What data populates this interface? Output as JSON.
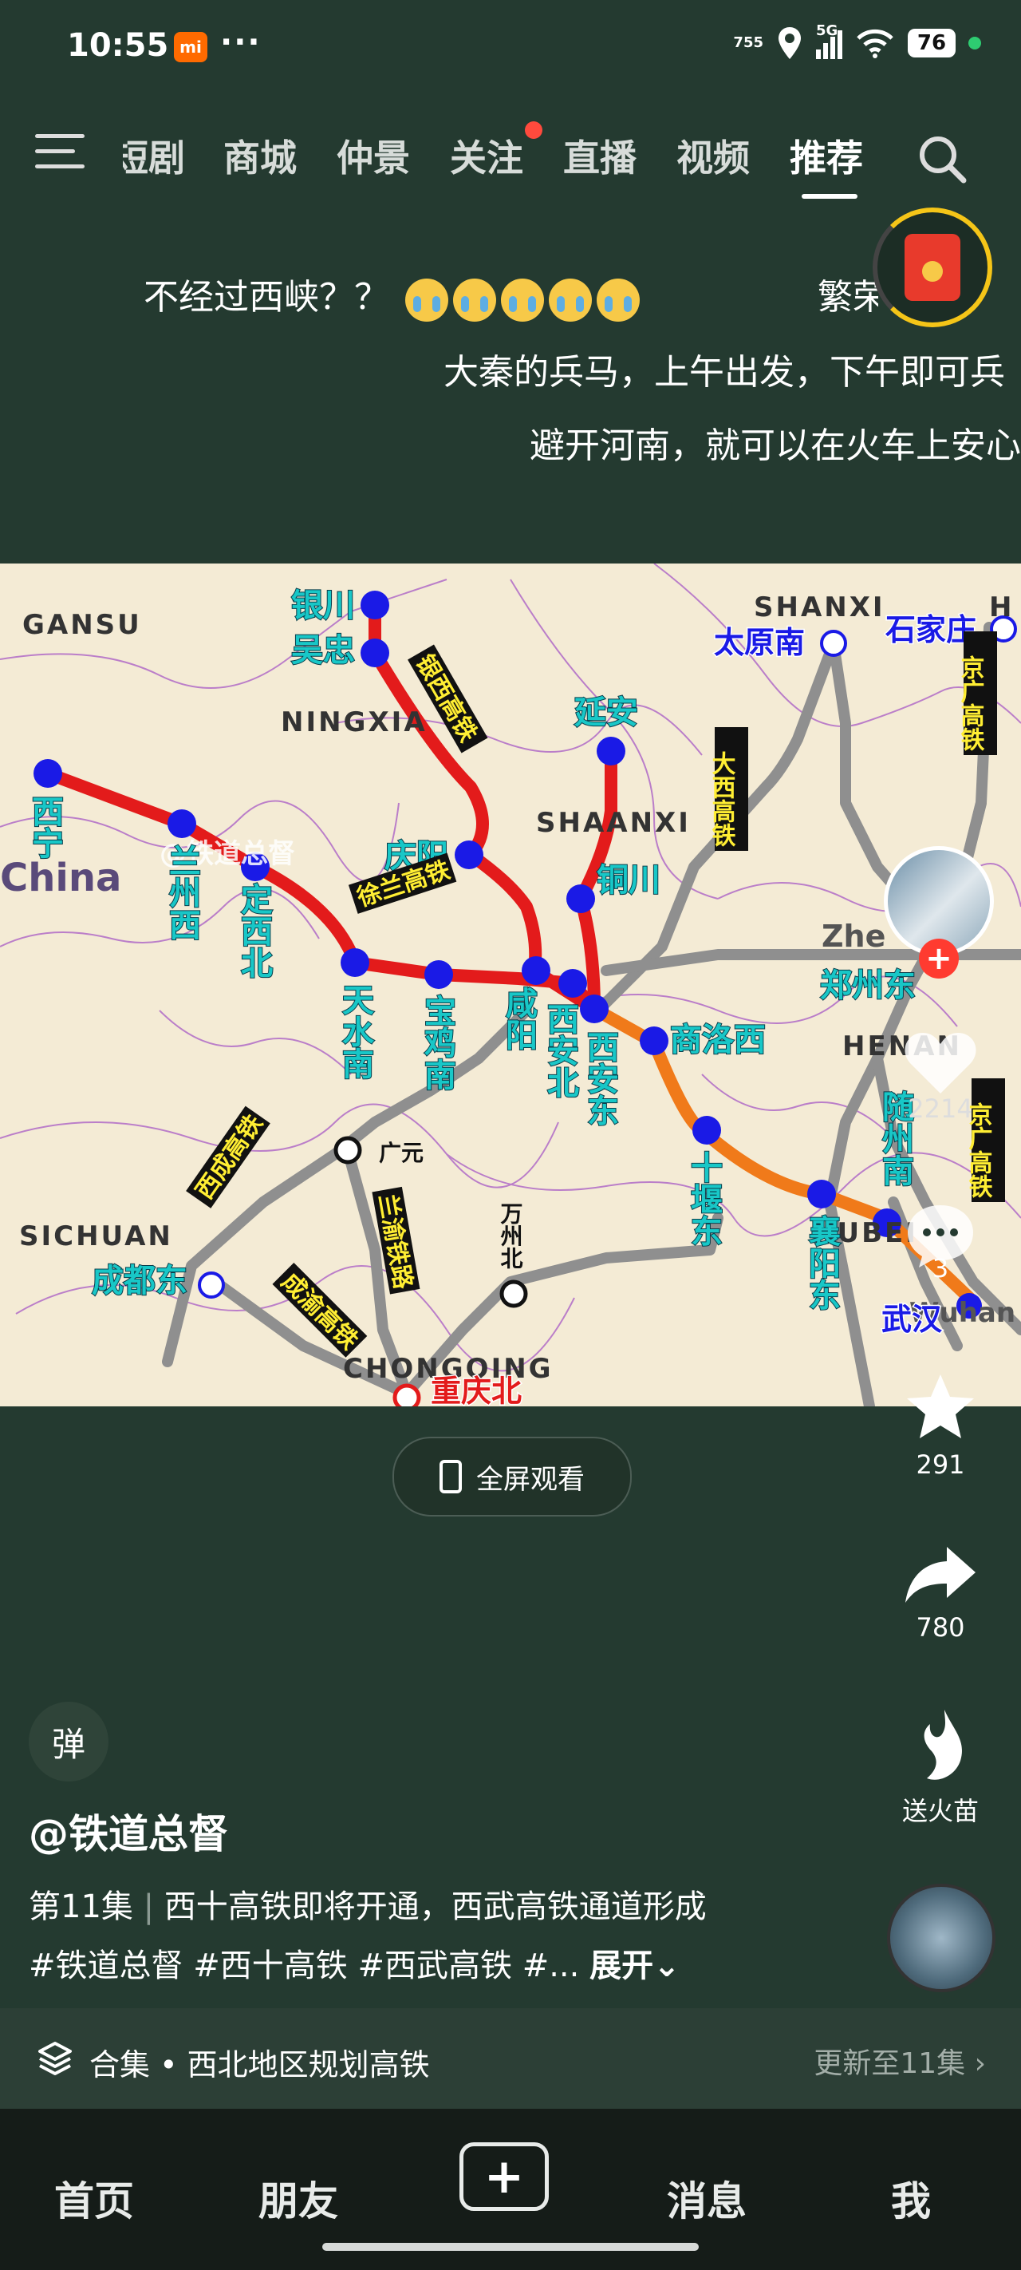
{
  "status_bar": {
    "time": "10:55",
    "mi_badge": "mi",
    "dots": "···",
    "net_rate_top": "755",
    "net_rate_bottom": "",
    "signal": "5G",
    "battery": "76"
  },
  "top_nav": {
    "tabs": [
      {
        "label": "短剧"
      },
      {
        "label": "商城"
      },
      {
        "label": "仲景"
      },
      {
        "label": "关注"
      },
      {
        "label": "直播"
      },
      {
        "label": "视频"
      },
      {
        "label": "推荐"
      }
    ],
    "active_tab": "推荐"
  },
  "danmaku": [
    {
      "text": "不经过西峡？？"
    },
    {
      "text": "繁荣昌盛"
    },
    {
      "text": "大秦的兵马，上午出发，下午即可兵"
    },
    {
      "text": "避开河南，就可以在火车上安心"
    }
  ],
  "map": {
    "provinces": [
      "GANSU",
      "NINGXIA",
      "SHANXI",
      "SHAANXI",
      "HENAN",
      "HUBEI",
      "SICHUAN",
      "CHONGQING",
      "China",
      "Zhe",
      "Wuhan",
      "H"
    ],
    "cities": {
      "yinchuan": "银川",
      "wuzhong": "吴忠",
      "yanan": "延安",
      "taiyuannan": "太原南",
      "shijiazhuang": "石家庄",
      "xining": "西宁",
      "lanzhouxi": "兰州西",
      "dingxibei": "定西北",
      "qingyang": "庆阳",
      "tongchuan": "铜川",
      "tianshuinan": "天水南",
      "baojinan": "宝鸡南",
      "xianyang": "咸阳",
      "xianbei": "西安北",
      "xiandong": "西安东",
      "shangluoxi": "商洛西",
      "zhengzhoudong": "郑州东",
      "guangyuan": "广元",
      "wanzhoubei": "万州北",
      "shiyandong": "十堰东",
      "xiangyangdong": "襄阳东",
      "suizhounan": "随州南",
      "chengdudong": "成都东",
      "chongqingbei": "重庆北",
      "wuhan": "武汉"
    },
    "lines": {
      "yinxi": "银西高铁",
      "daxi": "大西高铁",
      "xulan": "徐兰高铁",
      "jingguang1": "京广高铁",
      "jingguang2": "京广高铁",
      "xicheng": "西成高铁",
      "lanyu": "兰渝铁路",
      "chengyu": "成渝高铁"
    },
    "watermark": "@铁道总督",
    "colors": {
      "new_line": "#e31b1b",
      "xishi_line": "#f07a1a",
      "existing": "#8f8f8f",
      "station": "#1a1ae6"
    }
  },
  "fullscreen": {
    "label": "全屏观看"
  },
  "right_rail": {
    "likes": "2214",
    "comments": "3",
    "favorites": "291",
    "shares": "780",
    "gift_label": "送火苗"
  },
  "post": {
    "danmu_toggle": "弹",
    "author": "@铁道总督",
    "episode": "第11集",
    "title": "西十高铁即将开通，西武高铁通道形成",
    "hashtags": "#铁道总督 #西十高铁 #西武高铁 #...",
    "expand": "展开"
  },
  "collection": {
    "label": "合集 • 西北地区规划高铁",
    "update": "更新至11集"
  },
  "bottom_nav": {
    "home": "首页",
    "friends": "朋友",
    "messages": "消息",
    "me": "我"
  }
}
